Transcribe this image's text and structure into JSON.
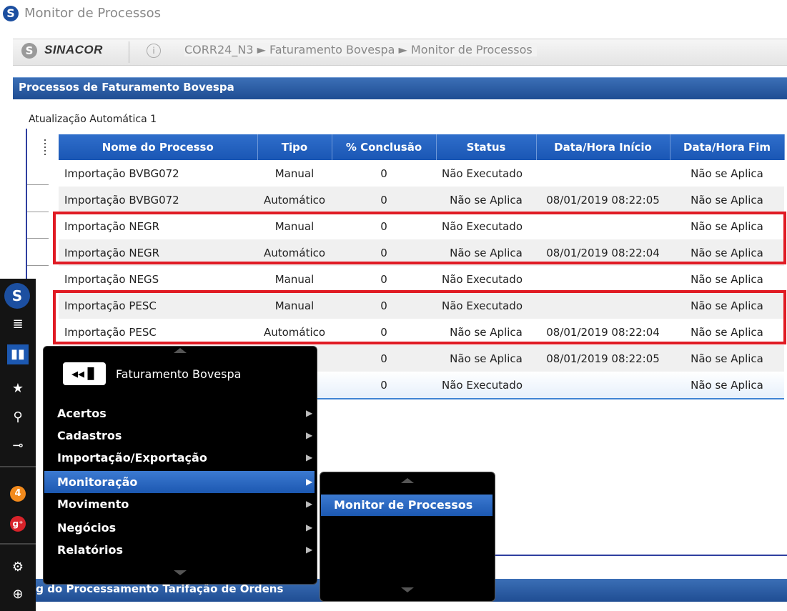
{
  "window": {
    "title": "Monitor de Processos",
    "logo_letter": "S"
  },
  "header": {
    "brand": "SINACOR",
    "brand_logo_letter": "S",
    "info_icon": "info-icon",
    "breadcrumb": "CORR24_N3 ► Faturamento Bovespa ► Monitor de Processos"
  },
  "panel": {
    "title": "Processos de Faturamento Bovespa",
    "auto_update": "Atualização Automática 1"
  },
  "table": {
    "columns": [
      "Nome do Processo",
      "Tipo",
      "% Conclusão",
      "Status",
      "Data/Hora Início",
      "Data/Hora Fim"
    ],
    "rows": [
      [
        "Importação BVBG072",
        "Manual",
        "0",
        "Não Executado",
        "",
        "Não se Aplica"
      ],
      [
        "Importação BVBG072",
        "Automático",
        "0",
        "Não se Aplica",
        "08/01/2019 08:22:05",
        "Não se Aplica"
      ],
      [
        "Importação NEGR",
        "Manual",
        "0",
        "Não Executado",
        "",
        "Não se Aplica"
      ],
      [
        "Importação NEGR",
        "Automático",
        "0",
        "Não se Aplica",
        "08/01/2019 08:22:04",
        "Não se Aplica"
      ],
      [
        "Importação NEGS",
        "Manual",
        "0",
        "Não Executado",
        "",
        "Não se Aplica"
      ],
      [
        "Importação PESC",
        "Manual",
        "0",
        "Não Executado",
        "",
        "Não se Aplica"
      ],
      [
        "Importação PESC",
        "Automático",
        "0",
        "Não se Aplica",
        "08/01/2019 08:22:04",
        "Não se Aplica"
      ],
      [
        "",
        "co",
        "0",
        "Não se Aplica",
        "08/01/2019 08:22:05",
        "Não se Aplica"
      ],
      [
        "",
        "",
        "0",
        "Não Executado",
        "",
        "Não se Aplica"
      ]
    ]
  },
  "dock": {
    "icons": [
      "sinacor-logo-icon",
      "list-icon",
      "chart-icon",
      "star-icon",
      "search-icon",
      "key-icon",
      "notification-badge-icon",
      "google-plus-icon",
      "tools-icon",
      "zoom-in-icon"
    ],
    "badge_count": "4",
    "logo_letter": "S",
    "gplus_label": "g⁺"
  },
  "menu": {
    "module_icon": "◀◀▐▌",
    "module_title": "Faturamento Bovespa",
    "items": [
      "Acertos",
      "Cadastros",
      "Importação/Exportação",
      "Monitoração",
      "Movimento",
      "Negócios",
      "Relatórios"
    ],
    "active_item": "Monitoração",
    "submenu": [
      "Monitor de Processos"
    ]
  },
  "bottom_panel": {
    "title": "og do Processamento Tarifação de Ordens"
  },
  "colors": {
    "accent": "#1f4d93",
    "highlight": "#e01b24",
    "menu_bg": "#000000"
  }
}
